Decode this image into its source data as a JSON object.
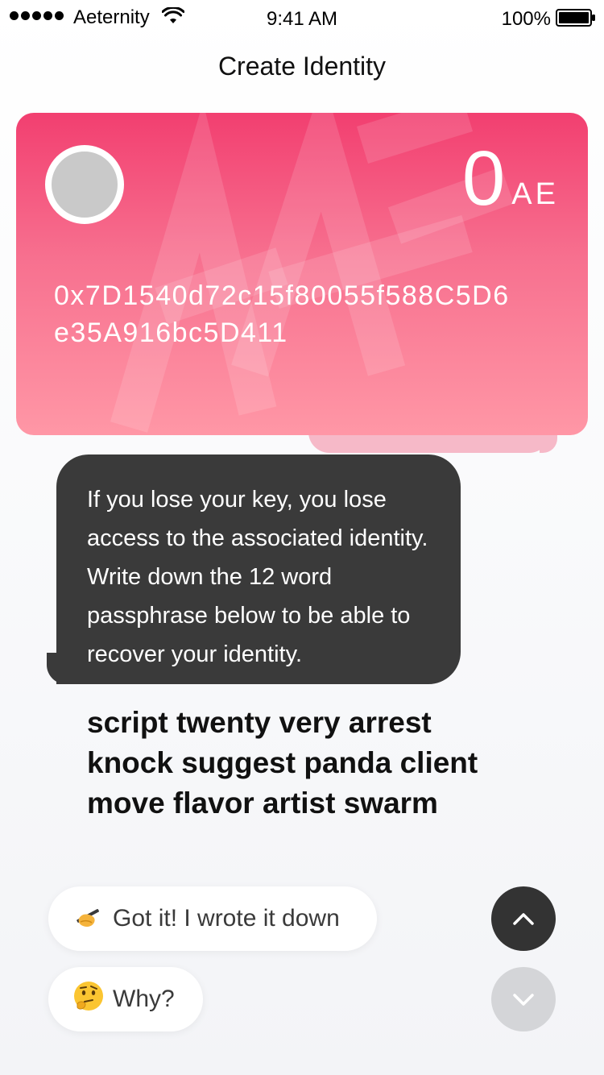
{
  "status_bar": {
    "carrier": "Aeternity",
    "time": "9:41 AM",
    "battery_percent": "100%",
    "signal_bars": 5,
    "icons": [
      "signal-dots-icon",
      "wifi-icon",
      "battery-icon"
    ]
  },
  "header": {
    "title": "Create Identity"
  },
  "identity_card": {
    "balance_value": "0",
    "balance_unit": "AE",
    "address_line1": "0x7D1540d72c15f80055f588C5D6",
    "address_line2": "e35A916bc5D411",
    "colors": {
      "gradient_top": "#f23f70",
      "gradient_bottom": "#ff97a6",
      "avatar": "#c9c9c9"
    }
  },
  "message": {
    "text": "If you lose your key, you lose access to the associated identity. Write down the 12 word passphrase below to be able to recover your identity."
  },
  "passphrase": {
    "line1": "script twenty very arrest",
    "line2": "knock suggest panda client",
    "line3": "move flavor artist swarm"
  },
  "replies": {
    "got_it": {
      "emoji": "✍",
      "label": "Got it! I wrote it down",
      "icon": "writing-hand-icon"
    },
    "why": {
      "emoji": "🤔",
      "label": "Why?",
      "icon": "thinking-face-icon"
    }
  },
  "scroll_controls": {
    "up_icon": "chevron-up-icon",
    "down_icon": "chevron-down-icon",
    "colors": {
      "up": "#333333",
      "down": "#d4d5d8"
    }
  }
}
